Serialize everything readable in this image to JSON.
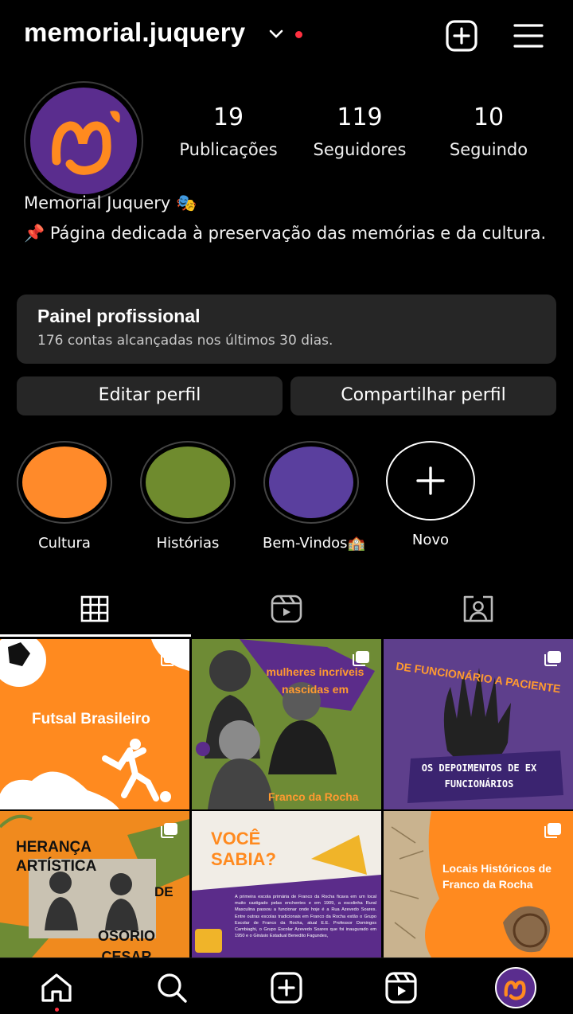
{
  "header": {
    "username": "memorial.juquery",
    "add_icon": "plus-square-icon",
    "menu_icon": "hamburger-menu-icon"
  },
  "profile": {
    "avatar_text": "MJ",
    "stats": [
      {
        "value": "19",
        "label": "Publicações"
      },
      {
        "value": "119",
        "label": "Seguidores"
      },
      {
        "value": "10",
        "label": "Seguindo"
      }
    ],
    "name": "Memorial Juquery 🎭",
    "bio": "📌 Página dedicada à preservação das memórias e da cultura."
  },
  "panel": {
    "title": "Painel profissional",
    "subtitle": "176 contas alcançadas nos últimos 30 dias."
  },
  "buttons": {
    "edit": "Editar perfil",
    "share": "Compartilhar perfil"
  },
  "highlights": [
    {
      "label": "Cultura",
      "color": "#ff8a2a"
    },
    {
      "label": "Histórias",
      "color": "#6f8b2e"
    },
    {
      "label": "Bem-Vindos🏫",
      "color": "#5a3f9e"
    },
    {
      "label": "Novo",
      "color": "#000000"
    }
  ],
  "tabs": [
    "grid-icon",
    "reels-icon",
    "tagged-icon"
  ],
  "posts": [
    {
      "title": "Futsal Brasileiro",
      "bg": "#ff8a1f"
    },
    {
      "title": "mulheres incríveis nascidas em",
      "footer": "Franco da Rocha",
      "bg": "#6e8b35"
    },
    {
      "title": "DE FUNCIONÁRIO A PACIENTE",
      "footer": "OS DEPOIMENTOS DE EX FUNCIONÁRIOS",
      "bg": "#5e3f8c"
    },
    {
      "title": "HERANÇA ARTÍSTICA",
      "mid": "DE",
      "footer": "OSORIO CESAR",
      "bg": "#f08a1e"
    },
    {
      "title": "VOCÊ SABIA?",
      "body": "A primeira escola primária de Franco da Rocha ficava em um local muito castigado pelas enchentes e em 1909, a escolinha Rural Masculina passou a funcionar onde hoje é a Rua Azevedo Soares. Entre outras escolas tradicionais em Franco da Rocha estão o Grupo Escolar de Franco da Rocha, atual E.E. Professor Domingos Cambiaghi, o Grupo Escolar Azevedo Soares que foi inaugurado em 1950 e o Ginásio Estadual Benedito Fagundes,",
      "bg": "#f1ede6"
    },
    {
      "title": "Locais Históricos de Franco da Rocha",
      "bg": "#ff8a1f"
    }
  ],
  "nav": [
    "home-icon",
    "search-icon",
    "create-icon",
    "reels-icon",
    "profile-avatar"
  ]
}
